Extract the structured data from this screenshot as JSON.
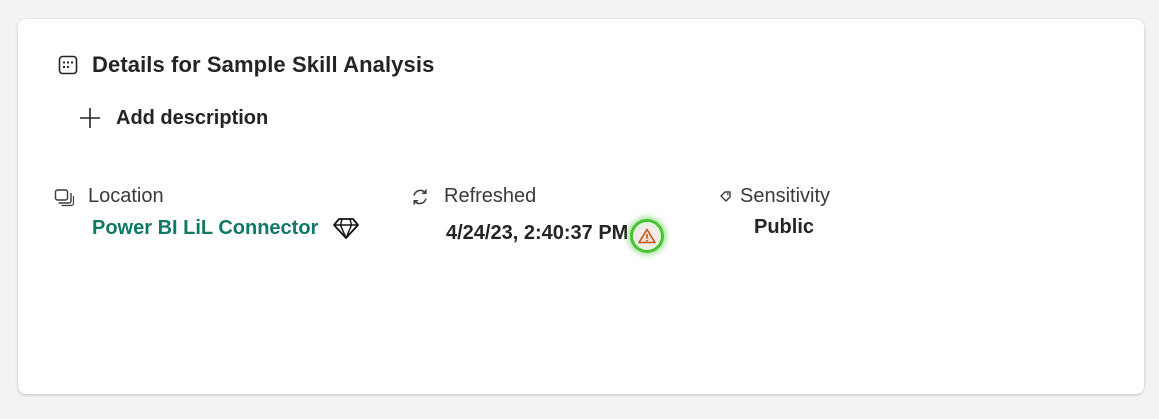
{
  "details": {
    "title": "Details for Sample Skill Analysis",
    "title_icon": "details-grid-icon"
  },
  "add_description": {
    "label": "Add description",
    "icon": "plus-icon"
  },
  "location": {
    "label": "Location",
    "value": "Power BI LiL Connector",
    "icon": "location-icon",
    "premium_icon": "diamond-icon",
    "link_color": "#117865"
  },
  "refreshed": {
    "label": "Refreshed",
    "value": "4/24/23, 2:40:37 PM",
    "icon": "refresh-icon",
    "status_icon": "warning-icon",
    "warning_color": "#c4531c"
  },
  "sensitivity": {
    "label": "Sensitivity",
    "value": "Public",
    "icon": "sensitivity-tag-icon"
  }
}
